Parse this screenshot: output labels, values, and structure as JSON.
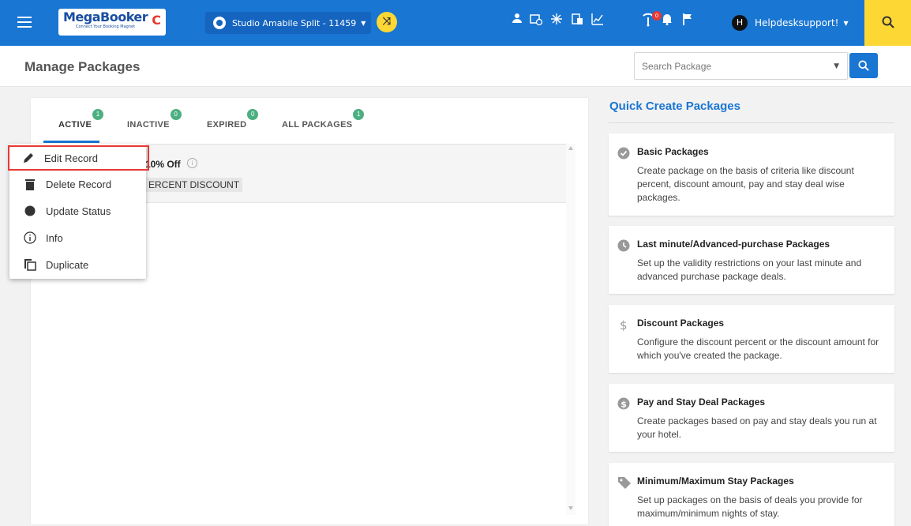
{
  "app": {
    "logo_text": "MegaBooker",
    "logo_tagline": "Connect Your Booking Magnet",
    "property_name": "Studio Amabile Split - 11459",
    "notification_count": "0",
    "user_initial": "H",
    "user_name": "Helpdesksupport!"
  },
  "header": {
    "title": "Manage Packages",
    "search_placeholder": "Search Package"
  },
  "tabs": [
    {
      "label": "ACTIVE",
      "count": "1"
    },
    {
      "label": "INACTIVE",
      "count": "0"
    },
    {
      "label": "EXPIRED",
      "count": "0"
    },
    {
      "label": "ALL PACKAGES",
      "count": "1"
    }
  ],
  "package_row": {
    "title": "10% Off",
    "type": "ERCENT DISCOUNT"
  },
  "context_menu": [
    {
      "label": "Edit Record",
      "icon": "pencil-icon"
    },
    {
      "label": "Delete Record",
      "icon": "trash-icon"
    },
    {
      "label": "Update Status",
      "icon": "circle-icon"
    },
    {
      "label": "Info",
      "icon": "info-icon"
    },
    {
      "label": "Duplicate",
      "icon": "copy-icon"
    }
  ],
  "quick_create": {
    "title": "Quick Create Packages",
    "cards": [
      {
        "title": "Basic Packages",
        "desc": "Create package on the basis of criteria like discount percent, discount amount, pay and stay deal wise packages.",
        "icon": "check-circle-icon"
      },
      {
        "title": "Last minute/Advanced-purchase Packages",
        "desc": "Set up the validity restrictions on your last minute and advanced purchase package deals.",
        "icon": "clock-icon"
      },
      {
        "title": "Discount Packages",
        "desc": "Configure the discount percent or the discount amount for which you've created the package.",
        "icon": "dollar-icon"
      },
      {
        "title": "Pay and Stay Deal Packages",
        "desc": "Create packages based on pay and stay deals you run at your hotel.",
        "icon": "dollar-circle-icon"
      },
      {
        "title": "Minimum/Maximum Stay Packages",
        "desc": "Set up packages on the basis of deals you provide for maximum/minimum nights of stay.",
        "icon": "tag-icon"
      }
    ]
  },
  "colors": {
    "primary": "#1976d2",
    "accent_yellow": "#fdd835",
    "badge_green": "#4caf81",
    "highlight_red": "#e53935"
  }
}
